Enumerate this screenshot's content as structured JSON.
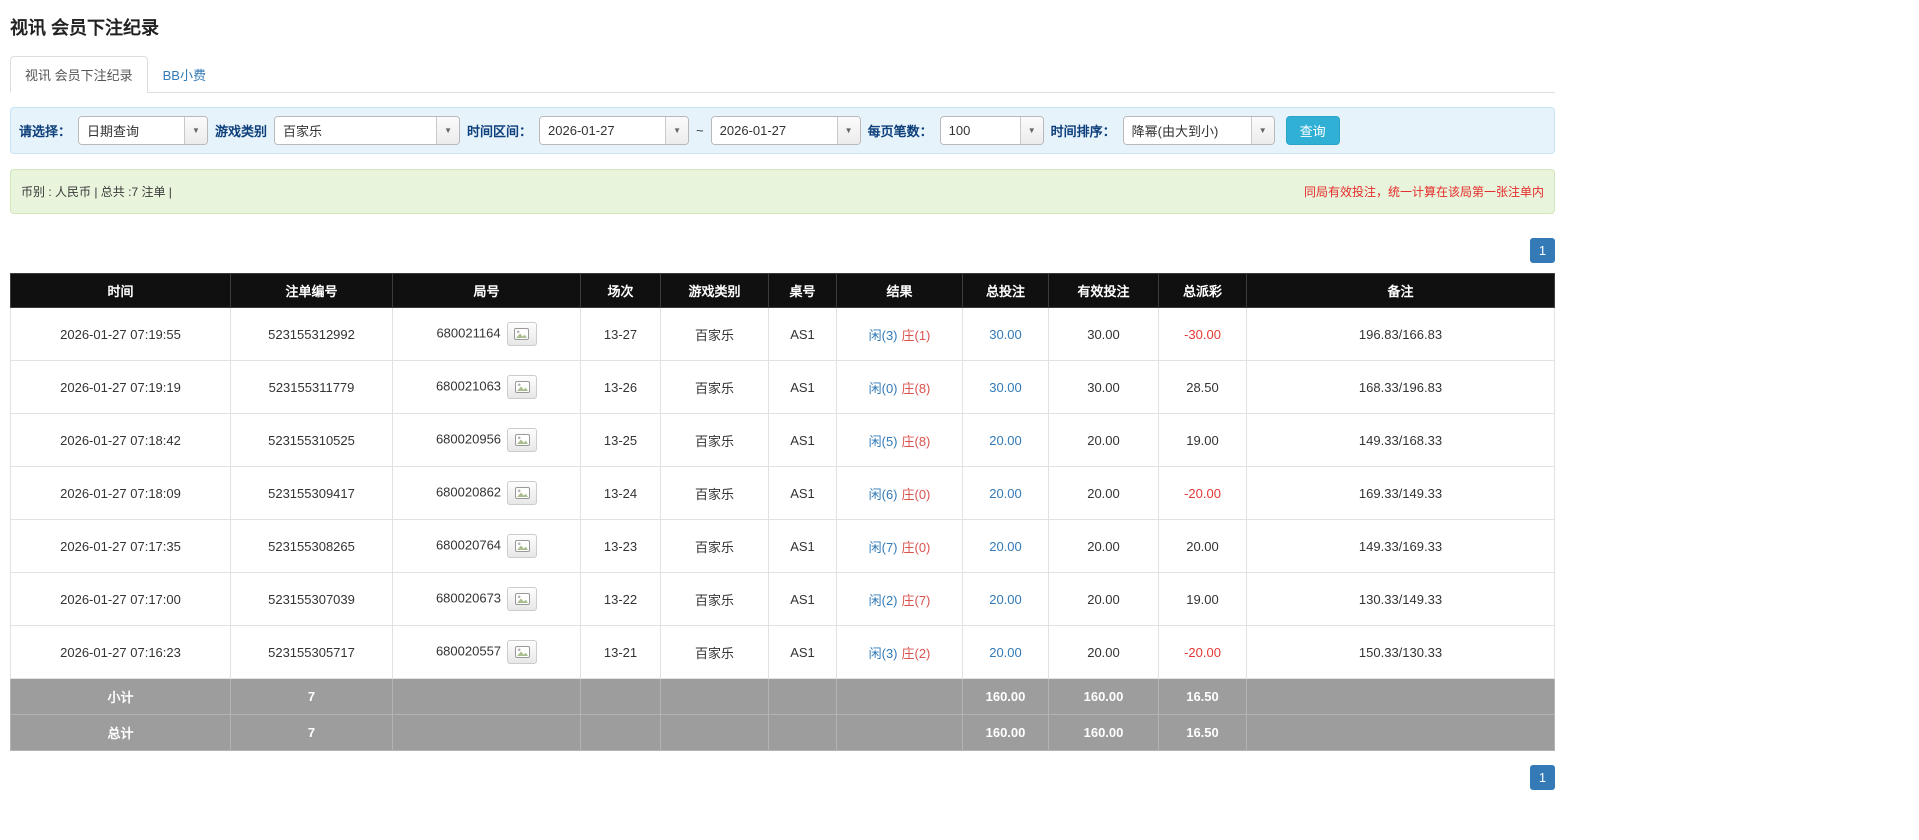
{
  "page": {
    "title": "视讯 会员下注纪录"
  },
  "tabs": [
    {
      "label": "视讯 会员下注纪录",
      "active": true
    },
    {
      "label": "BB小费",
      "active": false
    }
  ],
  "filters": {
    "select_label": "请选择：",
    "select_value": "日期查询",
    "game_type_label": "游戏类别",
    "game_type_value": "百家乐",
    "date_range_label": "时间区间：",
    "date_from": "2026-01-27",
    "date_separator": "~",
    "date_to": "2026-01-27",
    "page_size_label": "每页笔数：",
    "page_size_value": "100",
    "sort_label": "时间排序：",
    "sort_value": "降幂(由大到小)",
    "search_button_label": "查询"
  },
  "info_bar": {
    "summary": "币别 : 人民币 | 总共 :7 注单 |",
    "notice": "同局有效投注，统一计算在该局第一张注单内"
  },
  "pagination": {
    "current_page": "1"
  },
  "icons": {
    "dropdown_arrow": "▼",
    "round_media": "image-icon"
  },
  "colors": {
    "accent_blue": "#337ab7",
    "search_button_blue": "#31b0d5",
    "notice_red": "#e52b2b",
    "player_blue": "#337ab7",
    "banker_red": "#d9534f",
    "negative_red": "#e53935",
    "filter_bar_bg": "#e7f3fb",
    "info_bar_bg": "#e9f4dc",
    "table_header_bg": "#101010",
    "footer_row_bg": "#9d9d9d"
  },
  "table": {
    "headers": [
      "时间",
      "注单编号",
      "局号",
      "场次",
      "游戏类别",
      "桌号",
      "结果",
      "总投注",
      "有效投注",
      "总派彩",
      "备注"
    ],
    "rows": [
      {
        "time": "2026-01-27 07:19:55",
        "bet_id": "523155312992",
        "round_id": "680021164",
        "session": "13-27",
        "game_type": "百家乐",
        "table_no": "AS1",
        "result_player": "闲(3)",
        "result_banker": "庄(1)",
        "total_bet": "30.00",
        "valid_bet": "30.00",
        "payout": "-30.00",
        "note": "196.83/166.83"
      },
      {
        "time": "2026-01-27 07:19:19",
        "bet_id": "523155311779",
        "round_id": "680021063",
        "session": "13-26",
        "game_type": "百家乐",
        "table_no": "AS1",
        "result_player": "闲(0)",
        "result_banker": "庄(8)",
        "total_bet": "30.00",
        "valid_bet": "30.00",
        "payout": "28.50",
        "note": "168.33/196.83"
      },
      {
        "time": "2026-01-27 07:18:42",
        "bet_id": "523155310525",
        "round_id": "680020956",
        "session": "13-25",
        "game_type": "百家乐",
        "table_no": "AS1",
        "result_player": "闲(5)",
        "result_banker": "庄(8)",
        "total_bet": "20.00",
        "valid_bet": "20.00",
        "payout": "19.00",
        "note": "149.33/168.33"
      },
      {
        "time": "2026-01-27 07:18:09",
        "bet_id": "523155309417",
        "round_id": "680020862",
        "session": "13-24",
        "game_type": "百家乐",
        "table_no": "AS1",
        "result_player": "闲(6)",
        "result_banker": "庄(0)",
        "total_bet": "20.00",
        "valid_bet": "20.00",
        "payout": "-20.00",
        "note": "169.33/149.33"
      },
      {
        "time": "2026-01-27 07:17:35",
        "bet_id": "523155308265",
        "round_id": "680020764",
        "session": "13-23",
        "game_type": "百家乐",
        "table_no": "AS1",
        "result_player": "闲(7)",
        "result_banker": "庄(0)",
        "total_bet": "20.00",
        "valid_bet": "20.00",
        "payout": "20.00",
        "note": "149.33/169.33"
      },
      {
        "time": "2026-01-27 07:17:00",
        "bet_id": "523155307039",
        "round_id": "680020673",
        "session": "13-22",
        "game_type": "百家乐",
        "table_no": "AS1",
        "result_player": "闲(2)",
        "result_banker": "庄(7)",
        "total_bet": "20.00",
        "valid_bet": "20.00",
        "payout": "19.00",
        "note": "130.33/149.33"
      },
      {
        "time": "2026-01-27 07:16:23",
        "bet_id": "523155305717",
        "round_id": "680020557",
        "session": "13-21",
        "game_type": "百家乐",
        "table_no": "AS1",
        "result_player": "闲(3)",
        "result_banker": "庄(2)",
        "total_bet": "20.00",
        "valid_bet": "20.00",
        "payout": "-20.00",
        "note": "150.33/130.33"
      }
    ],
    "subtotal": {
      "label": "小计",
      "count": "7",
      "total_bet": "160.00",
      "valid_bet": "160.00",
      "payout": "16.50"
    },
    "total": {
      "label": "总计",
      "count": "7",
      "total_bet": "160.00",
      "valid_bet": "160.00",
      "payout": "16.50"
    }
  }
}
